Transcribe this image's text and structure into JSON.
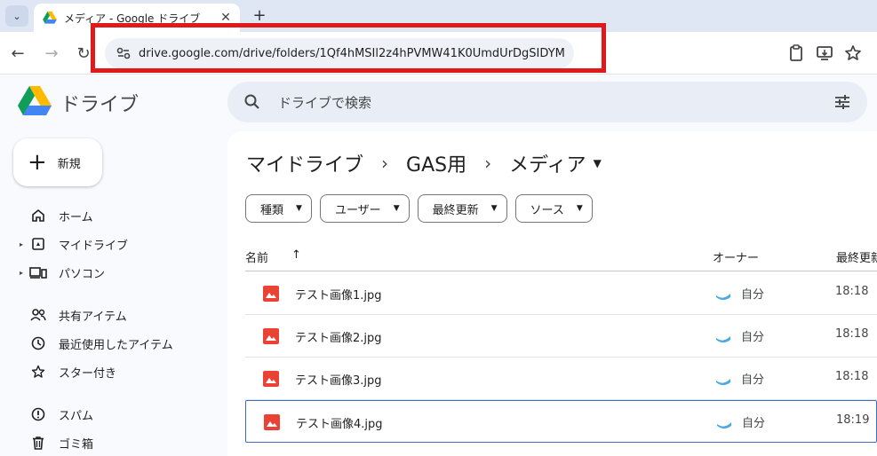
{
  "browser": {
    "tab_title": "メディア - Google ドライブ",
    "url": "drive.google.com/drive/folders/1Qf4hMSIl2z4hPVMW41K0UmdUrDgSIDYM",
    "highlight_color": "#e01a1a"
  },
  "app": {
    "name": "ドライブ",
    "search_placeholder": "ドライブで検索"
  },
  "sidebar": {
    "new_button": "新規",
    "items": [
      {
        "label": "ホーム",
        "icon": "home-icon"
      },
      {
        "label": "マイドライブ",
        "icon": "my-drive-icon"
      },
      {
        "label": "パソコン",
        "icon": "computers-icon"
      },
      {
        "label": "共有アイテム",
        "icon": "shared-icon"
      },
      {
        "label": "最近使用したアイテム",
        "icon": "clock-icon"
      },
      {
        "label": "スター付き",
        "icon": "star-icon"
      },
      {
        "label": "スパム",
        "icon": "spam-icon"
      },
      {
        "label": "ゴミ箱",
        "icon": "trash-icon"
      }
    ]
  },
  "breadcrumb": {
    "items": [
      "マイドライブ",
      "GAS用",
      "メディア"
    ]
  },
  "filters": [
    "種類",
    "ユーザー",
    "最終更新",
    "ソース"
  ],
  "table": {
    "col_name": "名前",
    "col_owner": "オーナー",
    "col_modified": "最終更新",
    "rows": [
      {
        "name": "テスト画像1.jpg",
        "owner": "自分",
        "modified": "18:18"
      },
      {
        "name": "テスト画像2.jpg",
        "owner": "自分",
        "modified": "18:18"
      },
      {
        "name": "テスト画像3.jpg",
        "owner": "自分",
        "modified": "18:18"
      },
      {
        "name": "テスト画像4.jpg",
        "owner": "自分",
        "modified": "18:19"
      }
    ]
  }
}
